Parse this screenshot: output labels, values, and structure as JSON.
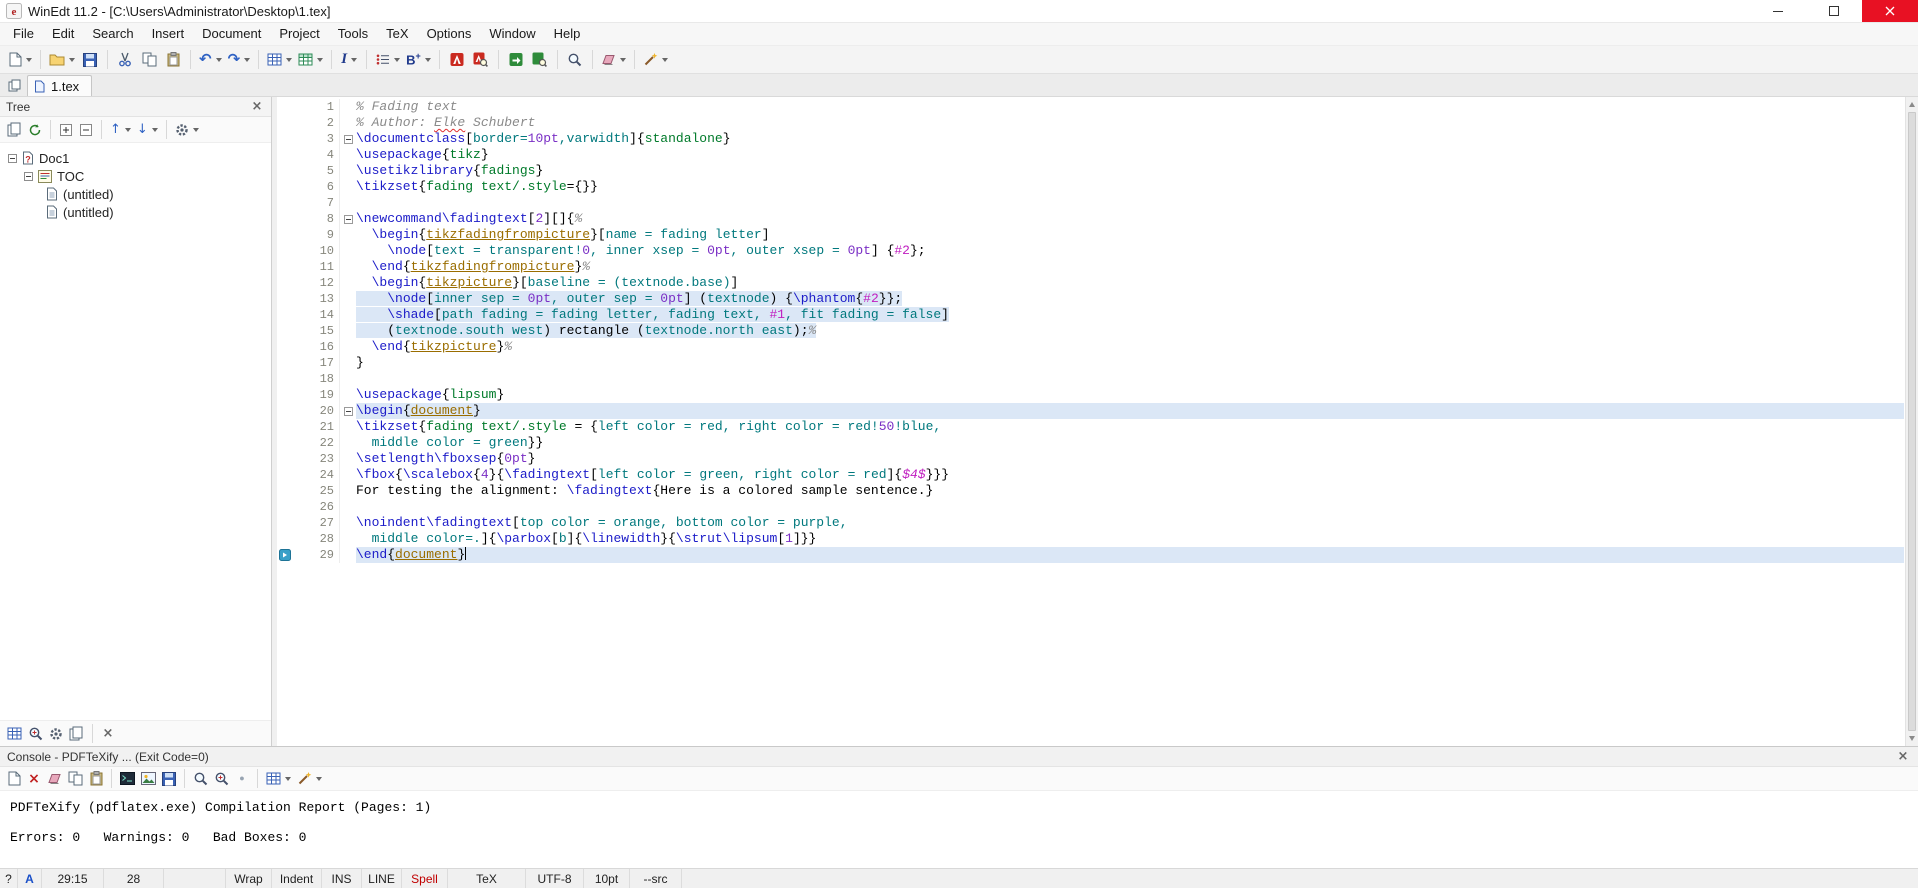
{
  "window": {
    "title": "WinEdt 11.2 - [C:\\Users\\Administrator\\Desktop\\1.tex]"
  },
  "menu": [
    "File",
    "Edit",
    "Search",
    "Insert",
    "Document",
    "Project",
    "Tools",
    "TeX",
    "Options",
    "Window",
    "Help"
  ],
  "toolbar": {
    "items": [
      {
        "name": "new-document",
        "glyph": "page",
        "dd": true
      },
      {
        "sep": true
      },
      {
        "name": "open-file",
        "glyph": "folder",
        "dd": true
      },
      {
        "name": "save",
        "glyph": "floppy"
      },
      {
        "sep": true
      },
      {
        "name": "cut",
        "glyph": "cut"
      },
      {
        "name": "copy",
        "glyph": "copy"
      },
      {
        "name": "paste",
        "glyph": "paste"
      },
      {
        "sep": true
      },
      {
        "name": "undo",
        "glyph": "undo",
        "dd": true
      },
      {
        "name": "redo",
        "glyph": "redo",
        "dd": true
      },
      {
        "sep": true
      },
      {
        "name": "insert-table",
        "glyph": "grid",
        "dd": true
      },
      {
        "name": "insert-matrix",
        "glyph": "grid2",
        "dd": true
      },
      {
        "sep": true
      },
      {
        "name": "tex-font-style",
        "glyph": "italicI",
        "dd": true
      },
      {
        "sep": true
      },
      {
        "name": "insert-list",
        "glyph": "list",
        "dd": true
      },
      {
        "name": "insert-symbol",
        "glyph": "bplus",
        "dd": true
      },
      {
        "sep": true
      },
      {
        "name": "pdftexify",
        "glyph": "pdfred"
      },
      {
        "name": "pdf-viewer",
        "glyph": "pdfmag"
      },
      {
        "sep": true
      },
      {
        "name": "texify",
        "glyph": "greendoc"
      },
      {
        "name": "dvi-viewer",
        "glyph": "greenview"
      },
      {
        "sep": true
      },
      {
        "name": "find",
        "glyph": "mag"
      },
      {
        "sep": true
      },
      {
        "name": "erase-output",
        "glyph": "eraser",
        "dd": true
      },
      {
        "sep": true
      },
      {
        "name": "macros",
        "glyph": "wand",
        "dd": true
      }
    ]
  },
  "tabs": {
    "active_label": "1.tex"
  },
  "tree": {
    "title": "Tree",
    "toolbar": [
      {
        "name": "tree-new",
        "glyph": "pagestack"
      },
      {
        "name": "tree-refresh",
        "glyph": "refresh"
      },
      {
        "sep": true
      },
      {
        "name": "tree-insert",
        "glyph": "plusbox"
      },
      {
        "name": "tree-remove",
        "glyph": "minusbox"
      },
      {
        "sep": true
      },
      {
        "name": "tree-expand",
        "glyph": "uparrow",
        "dd": true
      },
      {
        "name": "tree-collapse",
        "glyph": "downarrow",
        "dd": true
      },
      {
        "sep": true
      },
      {
        "name": "tree-options",
        "glyph": "gear",
        "dd": true
      }
    ],
    "items": [
      {
        "label": "Doc1",
        "icon": "docq",
        "level": 0,
        "expander": true
      },
      {
        "label": "TOC",
        "icon": "tocic",
        "level": 1,
        "expander": true
      },
      {
        "label": "(untitled)",
        "icon": "docsmall",
        "level": 2
      },
      {
        "label": "(untitled)",
        "icon": "docsmall",
        "level": 2
      }
    ],
    "bottombar": [
      {
        "name": "panel-layout",
        "glyph": "grid"
      },
      {
        "name": "panel-search",
        "glyph": "magplus"
      },
      {
        "name": "panel-gather",
        "glyph": "gear"
      },
      {
        "name": "panel-edit",
        "glyph": "pagestack"
      },
      {
        "sep": true
      },
      {
        "name": "panel-close",
        "glyph": "closex"
      }
    ]
  },
  "editor": {
    "cursor": {
      "line": 29,
      "col": 15
    },
    "marker_line": 29,
    "lines": [
      {
        "n": 1,
        "segs": [
          [
            "cm",
            "% Fading text"
          ]
        ]
      },
      {
        "n": 2,
        "segs": [
          [
            "cm",
            "% Author: "
          ],
          [
            "sp",
            "Elke"
          ],
          [
            "cm",
            " Schubert"
          ]
        ]
      },
      {
        "n": 3,
        "fold": true,
        "segs": [
          [
            "cs",
            "\\documentclass"
          ],
          [
            "tx",
            "["
          ],
          [
            "op",
            "border="
          ],
          [
            "nu",
            "10pt"
          ],
          [
            "op",
            ",varwidth"
          ],
          [
            "tx",
            "]{"
          ],
          [
            "gn",
            "standalone"
          ],
          [
            "tx",
            "}"
          ]
        ]
      },
      {
        "n": 4,
        "segs": [
          [
            "cs",
            "\\usepackage"
          ],
          [
            "tx",
            "{"
          ],
          [
            "gn",
            "tikz"
          ],
          [
            "tx",
            "}"
          ]
        ]
      },
      {
        "n": 5,
        "segs": [
          [
            "cs",
            "\\usetikzlibrary"
          ],
          [
            "tx",
            "{"
          ],
          [
            "gn",
            "fadings"
          ],
          [
            "tx",
            "}"
          ]
        ]
      },
      {
        "n": 6,
        "segs": [
          [
            "cs",
            "\\tikzset"
          ],
          [
            "tx",
            "{"
          ],
          [
            "gn",
            "fading text/.style"
          ],
          [
            "tx",
            "={}}"
          ]
        ]
      },
      {
        "n": 7,
        "segs": []
      },
      {
        "n": 8,
        "fold": true,
        "segs": [
          [
            "cs",
            "\\newcommand"
          ],
          [
            "cs",
            "\\fadingtext"
          ],
          [
            "tx",
            "["
          ],
          [
            "nu",
            "2"
          ],
          [
            "tx",
            "][]{"
          ],
          [
            "cm",
            "%"
          ]
        ]
      },
      {
        "n": 9,
        "segs": [
          [
            "tx",
            "  "
          ],
          [
            "cs",
            "\\begin"
          ],
          [
            "tx",
            "{"
          ],
          [
            "en",
            "tikzfadingfrompicture"
          ],
          [
            "tx",
            "}["
          ],
          [
            "op",
            "name = fading letter"
          ],
          [
            "tx",
            "]"
          ]
        ]
      },
      {
        "n": 10,
        "segs": [
          [
            "tx",
            "    "
          ],
          [
            "cs",
            "\\node"
          ],
          [
            "tx",
            "["
          ],
          [
            "op",
            "text = transparent!"
          ],
          [
            "nu",
            "0"
          ],
          [
            "op",
            ", inner xsep = "
          ],
          [
            "nu",
            "0pt"
          ],
          [
            "op",
            ", outer xsep = "
          ],
          [
            "nu",
            "0pt"
          ],
          [
            "tx",
            "] {"
          ],
          [
            "pm",
            "#2"
          ],
          [
            "tx",
            "};"
          ]
        ]
      },
      {
        "n": 11,
        "segs": [
          [
            "tx",
            "  "
          ],
          [
            "cs",
            "\\end"
          ],
          [
            "tx",
            "{"
          ],
          [
            "en",
            "tikzfadingfrompicture"
          ],
          [
            "tx",
            "}"
          ],
          [
            "cm",
            "%"
          ]
        ]
      },
      {
        "n": 12,
        "segs": [
          [
            "tx",
            "  "
          ],
          [
            "cs",
            "\\begin"
          ],
          [
            "tx",
            "{"
          ],
          [
            "en",
            "tikzpicture"
          ],
          [
            "tx",
            "}["
          ],
          [
            "op",
            "baseline = (textnode.base)"
          ],
          [
            "tx",
            "]"
          ]
        ]
      },
      {
        "n": 13,
        "hl": "block",
        "segs": [
          [
            "tx",
            "    "
          ],
          [
            "cs",
            "\\node"
          ],
          [
            "tx",
            "["
          ],
          [
            "op",
            "inner sep = "
          ],
          [
            "nu",
            "0pt"
          ],
          [
            "op",
            ", outer sep = "
          ],
          [
            "nu",
            "0pt"
          ],
          [
            "tx",
            "] ("
          ],
          [
            "op",
            "textnode"
          ],
          [
            "tx",
            ") {"
          ],
          [
            "cs",
            "\\phantom"
          ],
          [
            "tx",
            "{"
          ],
          [
            "pm",
            "#2"
          ],
          [
            "tx",
            "}};"
          ]
        ]
      },
      {
        "n": 14,
        "hl": "block",
        "segs": [
          [
            "tx",
            "    "
          ],
          [
            "cs",
            "\\shade"
          ],
          [
            "tx",
            "["
          ],
          [
            "op",
            "path fading = fading letter, fading text, "
          ],
          [
            "pm",
            "#1"
          ],
          [
            "op",
            ", fit fading = false"
          ],
          [
            "tx",
            "]"
          ]
        ]
      },
      {
        "n": 15,
        "hl": "block",
        "segs": [
          [
            "tx",
            "    ("
          ],
          [
            "op",
            "textnode.south west"
          ],
          [
            "tx",
            ") rectangle ("
          ],
          [
            "op",
            "textnode.north east"
          ],
          [
            "tx",
            ");"
          ],
          [
            "cm",
            "%"
          ]
        ]
      },
      {
        "n": 16,
        "segs": [
          [
            "tx",
            "  "
          ],
          [
            "cs",
            "\\end"
          ],
          [
            "tx",
            "{"
          ],
          [
            "en",
            "tikzpicture"
          ],
          [
            "tx",
            "}"
          ],
          [
            "cm",
            "%"
          ]
        ]
      },
      {
        "n": 17,
        "segs": [
          [
            "tx",
            "}"
          ]
        ]
      },
      {
        "n": 18,
        "segs": []
      },
      {
        "n": 19,
        "segs": [
          [
            "cs",
            "\\usepackage"
          ],
          [
            "tx",
            "{"
          ],
          [
            "gn",
            "lipsum"
          ],
          [
            "tx",
            "}"
          ]
        ]
      },
      {
        "n": 20,
        "hl": "full",
        "fold": true,
        "segs": [
          [
            "cs",
            "\\begin"
          ],
          [
            "tx",
            "{"
          ],
          [
            "en",
            "document"
          ],
          [
            "tx",
            "}"
          ]
        ]
      },
      {
        "n": 21,
        "segs": [
          [
            "cs",
            "\\tikzset"
          ],
          [
            "tx",
            "{"
          ],
          [
            "gn",
            "fading text/.style"
          ],
          [
            "tx",
            " = {"
          ],
          [
            "op",
            "left color = red, right color = red!"
          ],
          [
            "nu",
            "50"
          ],
          [
            "op",
            "!blue,"
          ]
        ]
      },
      {
        "n": 22,
        "segs": [
          [
            "op",
            "  middle color = green"
          ],
          [
            "tx",
            "}}"
          ]
        ]
      },
      {
        "n": 23,
        "segs": [
          [
            "cs",
            "\\setlength"
          ],
          [
            "cs",
            "\\fboxsep"
          ],
          [
            "tx",
            "{"
          ],
          [
            "nu",
            "0pt"
          ],
          [
            "tx",
            "}"
          ]
        ]
      },
      {
        "n": 24,
        "segs": [
          [
            "cs",
            "\\fbox"
          ],
          [
            "tx",
            "{"
          ],
          [
            "cs",
            "\\scalebox"
          ],
          [
            "tx",
            "{"
          ],
          [
            "nu",
            "4"
          ],
          [
            "tx",
            "}{"
          ],
          [
            "cs",
            "\\fadingtext"
          ],
          [
            "tx",
            "["
          ],
          [
            "op",
            "left color = green, right color = red"
          ],
          [
            "tx",
            "]{"
          ],
          [
            "mt",
            "$4$"
          ],
          [
            "tx",
            "}}}"
          ]
        ]
      },
      {
        "n": 25,
        "segs": [
          [
            "tx",
            "For testing the alignment: "
          ],
          [
            "cs",
            "\\fadingtext"
          ],
          [
            "tx",
            "{Here is a colored sample sentence.}"
          ]
        ]
      },
      {
        "n": 26,
        "segs": []
      },
      {
        "n": 27,
        "segs": [
          [
            "cs",
            "\\noindent"
          ],
          [
            "cs",
            "\\fadingtext"
          ],
          [
            "tx",
            "["
          ],
          [
            "op",
            "top color = orange, bottom color = purple,"
          ]
        ]
      },
      {
        "n": 28,
        "segs": [
          [
            "op",
            "  middle color=."
          ],
          [
            "tx",
            "]{"
          ],
          [
            "cs",
            "\\parbox"
          ],
          [
            "tx",
            "["
          ],
          [
            "op",
            "b"
          ],
          [
            "tx",
            "]{"
          ],
          [
            "cs",
            "\\linewidth"
          ],
          [
            "tx",
            "}{"
          ],
          [
            "cs",
            "\\strut"
          ],
          [
            "cs",
            "\\lipsum"
          ],
          [
            "tx",
            "["
          ],
          [
            "nu",
            "1"
          ],
          [
            "tx",
            "]}}"
          ]
        ]
      },
      {
        "n": 29,
        "hl": "full",
        "segs": [
          [
            "cs",
            "\\end"
          ],
          [
            "tx",
            "{"
          ],
          [
            "en",
            "document"
          ],
          [
            "tx",
            "}"
          ]
        ]
      }
    ]
  },
  "console": {
    "title": "Console - PDFTeXify ... (Exit Code=0)",
    "toolbar": [
      {
        "name": "console-doc",
        "glyph": "page"
      },
      {
        "name": "console-close-output",
        "glyph": "closered"
      },
      {
        "name": "console-erase",
        "glyph": "eraser"
      },
      {
        "name": "console-copy",
        "glyph": "copy"
      },
      {
        "name": "console-paste",
        "glyph": "paste"
      },
      {
        "sep": true
      },
      {
        "name": "console-view",
        "glyph": "consoleDark"
      },
      {
        "name": "console-image",
        "glyph": "imageIc"
      },
      {
        "name": "console-save",
        "glyph": "floppy"
      },
      {
        "sep": true
      },
      {
        "name": "console-find",
        "glyph": "mag"
      },
      {
        "name": "console-find-next",
        "glyph": "magplus"
      },
      {
        "name": "console-record",
        "glyph": "dot"
      },
      {
        "sep": true
      },
      {
        "name": "console-table",
        "glyph": "grid",
        "dd": true
      },
      {
        "name": "console-macros",
        "glyph": "wand",
        "dd": true
      }
    ],
    "output": [
      "PDFTeXify (pdflatex.exe) Compilation Report (Pages: 1)",
      "",
      "Errors: 0   Warnings: 0   Bad Boxes: 0"
    ]
  },
  "statusbar": {
    "items": [
      {
        "label": "?",
        "name": "help"
      },
      {
        "label": "A",
        "name": "input-mode",
        "accent": "blue"
      },
      {
        "label": "29:15",
        "name": "caret-position"
      },
      {
        "label": "28",
        "name": "line-count"
      },
      {
        "label": "",
        "name": "modified-indicator"
      },
      {
        "label": "Wrap",
        "name": "wrap-toggle"
      },
      {
        "label": "Indent",
        "name": "indent-toggle"
      },
      {
        "label": "INS",
        "name": "insert-mode"
      },
      {
        "label": "LINE",
        "name": "line-mode"
      },
      {
        "label": "Spell",
        "name": "spell-toggle",
        "accent": "red"
      },
      {
        "label": "TeX",
        "name": "document-mode"
      },
      {
        "label": "UTF-8",
        "name": "encoding"
      },
      {
        "label": "10pt",
        "name": "font-size-indicator"
      },
      {
        "label": "--src",
        "name": "src-toggle"
      },
      {
        "label": "",
        "name": "spacer"
      }
    ]
  },
  "colors": {
    "cmd": "#1b1bc8",
    "comment": "#8a8a8a",
    "env": "#9a6d00",
    "opt": "#00787d",
    "num": "#7a2fc5",
    "param": "#c01ec0",
    "str": "#007a2a",
    "hl": "#dbe7f6",
    "spell": "#e03030",
    "close": "#e81123",
    "blue": "#1a50c8",
    "red": "#c00000"
  }
}
